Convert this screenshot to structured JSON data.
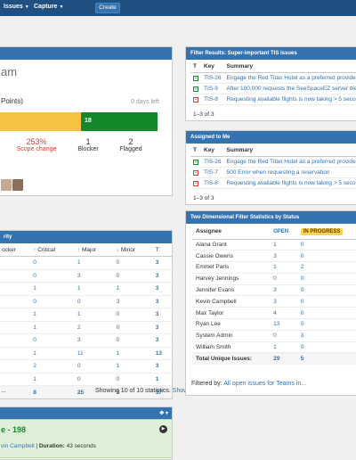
{
  "topbar": {
    "issues": "Issues",
    "capture": "Capture",
    "create": "Create"
  },
  "sprint": {
    "title_fragment": "am",
    "points_fragment": "Points)",
    "days_left": "0 days left",
    "bar_done_label": "18",
    "stats": [
      {
        "value": "253%",
        "label": "Scope change",
        "red": true
      },
      {
        "value": "1",
        "label": "Blocker",
        "red": false
      },
      {
        "value": "2",
        "label": "Flagged",
        "red": false
      }
    ],
    "scope_label_fragment": "%"
  },
  "priority": {
    "header_fragment": "rity",
    "columns": [
      "ocker",
      "Critical",
      "Major",
      "Minor",
      "T:"
    ],
    "rows": [
      [
        "",
        "0",
        "1",
        "0",
        "3"
      ],
      [
        "",
        "0",
        "3",
        "0",
        "3"
      ],
      [
        "",
        "1",
        "1",
        "1",
        "3"
      ],
      [
        "",
        "0",
        "0",
        "3",
        "3"
      ],
      [
        "",
        "1",
        "1",
        "0",
        "3"
      ],
      [
        "",
        "1",
        "2",
        "0",
        "3"
      ],
      [
        "",
        "0",
        "3",
        "0",
        "3"
      ],
      [
        "",
        "1",
        "11",
        "1",
        "13"
      ],
      [
        "",
        "2",
        "0",
        "1",
        "3"
      ],
      [
        "",
        "1",
        "0",
        "0",
        "1"
      ]
    ],
    "totals": [
      "",
      "8",
      "25",
      "3",
      "37"
    ],
    "footer": "Showing 10 of 10 statistics.",
    "show_less": "Show less",
    "footer_left": "..."
  },
  "build": {
    "title_fragment": "e - 198",
    "line": "vin Campbell",
    "duration_label": "Duration:",
    "duration_value": "43 seconds"
  },
  "filter_results": {
    "header": "Filter Results: Super-important TIS issues",
    "columns": [
      "T",
      "Key",
      "Summary"
    ],
    "rows": [
      {
        "type": "new",
        "key": "TIS-26",
        "summary": "Engage the Red Titan Hotel as a preferred provider"
      },
      {
        "type": "new",
        "key": "TIS-9",
        "summary": "After 100,000 requests the SeeSpaceEZ server dies"
      },
      {
        "type": "bug",
        "key": "TIS-8",
        "summary": "Requesting available flights is now taking > 5 seconds"
      }
    ],
    "pager_pre": "1–3",
    "pager_post": "of 3"
  },
  "assigned": {
    "header": "Assigned to Me",
    "columns": [
      "T",
      "Key",
      "Summary"
    ],
    "rows": [
      {
        "type": "new",
        "key": "TIS-26",
        "summary": "Engage the Red Titan Hotel as a preferred provider"
      },
      {
        "type": "bug",
        "key": "TIS-7",
        "summary": "500 Error when requesting a reservation"
      },
      {
        "type": "bug",
        "key": "TIS-8",
        "summary": "Requesting available flights is now taking > 5 seconds"
      }
    ],
    "pager_pre": "1–3",
    "pager_post": "of 3"
  },
  "two_d": {
    "header": "Two Dimensional Filter Statistics by Status",
    "columns": [
      "Assignee",
      "OPEN",
      "IN PROGRESS"
    ],
    "rows": [
      [
        "Alana Grant",
        "1",
        "0"
      ],
      [
        "Cassie Owens",
        "3",
        "0"
      ],
      [
        "Emmet Paris",
        "1",
        "2"
      ],
      [
        "Harvey Jennings",
        "0",
        "0"
      ],
      [
        "Jennifer Evans",
        "3",
        "0"
      ],
      [
        "Kevin Campbell",
        "3",
        "0"
      ],
      [
        "Max Taylor",
        "4",
        "0"
      ],
      [
        "Ryan Lee",
        "13",
        "0"
      ],
      [
        "System Admin",
        "0",
        "3"
      ],
      [
        "William Smith",
        "1",
        "0"
      ]
    ],
    "total_label": "Total Unique Issues:",
    "totals": [
      "29",
      "5"
    ],
    "filtered_by": "Filtered by:",
    "filter_link": "All open issues for Teams in..."
  },
  "colors": {
    "header_blue": "#3572b0",
    "nav_blue": "#205081",
    "progress_yellow": "#f6c342",
    "done_green": "#14892c"
  }
}
